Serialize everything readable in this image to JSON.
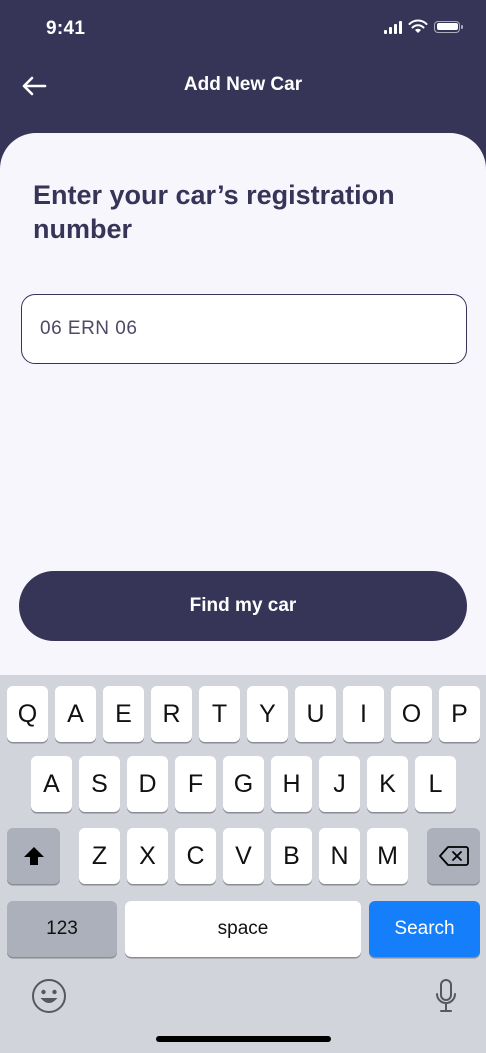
{
  "status_bar": {
    "time": "9:41"
  },
  "nav": {
    "title": "Add New Car"
  },
  "form": {
    "heading": "Enter your car’s registration number",
    "registration_value": "06 ERN 06",
    "button_label": "Find my car"
  },
  "keyboard": {
    "row1": [
      "Q",
      "A",
      "E",
      "R",
      "T",
      "Y",
      "U",
      "I",
      "O",
      "P"
    ],
    "row2": [
      "A",
      "S",
      "D",
      "F",
      "G",
      "H",
      "J",
      "K",
      "L"
    ],
    "row3": [
      "Z",
      "X",
      "C",
      "V",
      "B",
      "N",
      "M"
    ],
    "numbers_label": "123",
    "space_label": "space",
    "search_label": "Search"
  },
  "colors": {
    "brand": "#363457",
    "background": "#f7f6fd",
    "search_key": "#147efb"
  },
  "icons": [
    "arrow-left-icon",
    "signal-icon",
    "wifi-icon",
    "battery-icon",
    "shift-icon",
    "delete-icon",
    "emoji-icon",
    "microphone-icon"
  ]
}
